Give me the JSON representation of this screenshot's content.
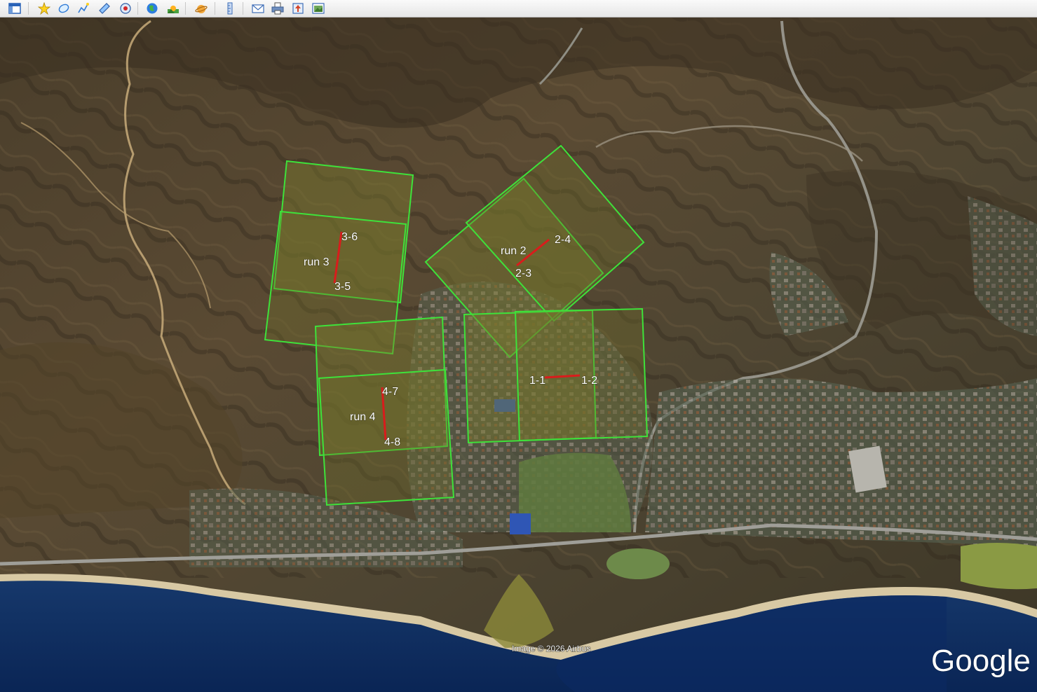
{
  "toolbar": {
    "buttons": [
      {
        "icon": "sidebar-toggle-icon"
      },
      {
        "icon": "add-placemark-icon"
      },
      {
        "icon": "add-polygon-icon"
      },
      {
        "icon": "add-path-icon"
      },
      {
        "icon": "add-image-overlay-icon"
      },
      {
        "icon": "record-tour-icon"
      },
      {
        "icon": "historical-imagery-icon"
      },
      {
        "icon": "sunlight-icon"
      },
      {
        "icon": "planet-switch-icon"
      },
      {
        "icon": "ruler-icon"
      },
      {
        "icon": "email-icon"
      },
      {
        "icon": "print-icon"
      },
      {
        "icon": "save-image-icon"
      },
      {
        "icon": "view-in-maps-icon"
      }
    ]
  },
  "map": {
    "overlay_color": "#3ee23a",
    "track_color": "#d91c1c",
    "labels": {
      "run3": "run 3",
      "p3_6": "3-6",
      "p3_5": "3-5",
      "run2": "run 2",
      "p2_4": "2-4",
      "p2_3": "2-3",
      "p1_1": "1-1",
      "p1_2": "1-2",
      "run4": "run 4",
      "p4_7": "4-7",
      "p4_8": "4-8"
    },
    "attribution": "Image © 2026 Airbus",
    "logo": "Google"
  }
}
